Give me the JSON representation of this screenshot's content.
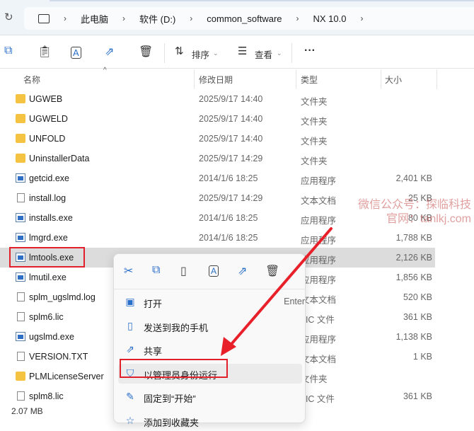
{
  "breadcrumb": [
    "此电脑",
    "软件 (D:)",
    "common_software",
    "NX 10.0"
  ],
  "toolbar": {
    "sort": "排序",
    "view": "查看",
    "more": "···"
  },
  "columns": {
    "name": "名称",
    "date": "修改日期",
    "type": "类型",
    "size": "大小"
  },
  "files": [
    {
      "name": "UGWEB",
      "date": "2025/9/17 14:40",
      "type": "文件夹",
      "size": "",
      "icon": "folder"
    },
    {
      "name": "UGWELD",
      "date": "2025/9/17 14:40",
      "type": "文件夹",
      "size": "",
      "icon": "folder"
    },
    {
      "name": "UNFOLD",
      "date": "2025/9/17 14:40",
      "type": "文件夹",
      "size": "",
      "icon": "folder"
    },
    {
      "name": "UninstallerData",
      "date": "2025/9/17 14:29",
      "type": "文件夹",
      "size": "",
      "icon": "folder"
    },
    {
      "name": "getcid.exe",
      "date": "2014/1/6 18:25",
      "type": "应用程序",
      "size": "2,401 KB",
      "icon": "exe"
    },
    {
      "name": "install.log",
      "date": "2025/9/17 14:29",
      "type": "文本文档",
      "size": "25 KB",
      "icon": "txt"
    },
    {
      "name": "installs.exe",
      "date": "2014/1/6 18:25",
      "type": "应用程序",
      "size": "80 KB",
      "icon": "exe"
    },
    {
      "name": "lmgrd.exe",
      "date": "2014/1/6 18:25",
      "type": "应用程序",
      "size": "1,788 KB",
      "icon": "exe"
    },
    {
      "name": "lmtools.exe",
      "date": "",
      "type": "应用程序",
      "size": "2,126 KB",
      "icon": "exe"
    },
    {
      "name": "lmutil.exe",
      "date": "",
      "type": "应用程序",
      "size": "1,856 KB",
      "icon": "exe"
    },
    {
      "name": "splm_ugslmd.log",
      "date": "",
      "type": "文本文档",
      "size": "520 KB",
      "icon": "txt"
    },
    {
      "name": "splm6.lic",
      "date": "",
      "type": "LIC 文件",
      "size": "361 KB",
      "icon": "txt"
    },
    {
      "name": "ugslmd.exe",
      "date": "",
      "type": "应用程序",
      "size": "1,138 KB",
      "icon": "exe"
    },
    {
      "name": "VERSION.TXT",
      "date": "",
      "type": "文本文档",
      "size": "1 KB",
      "icon": "txt"
    },
    {
      "name": "PLMLicenseServer",
      "date": "",
      "type": "文件夹",
      "size": "",
      "icon": "folder"
    },
    {
      "name": "splm8.lic",
      "date": "",
      "type": "LIC 文件",
      "size": "361 KB",
      "icon": "txt"
    }
  ],
  "context_menu": {
    "items": [
      {
        "label": "打开",
        "shortcut": "Enter",
        "icon": "open-icon"
      },
      {
        "label": "发送到我的手机",
        "shortcut": "",
        "icon": "phone-icon"
      },
      {
        "label": "共享",
        "shortcut": "",
        "icon": "share-icon"
      },
      {
        "label": "以管理员身份运行",
        "shortcut": "",
        "icon": "shield-icon"
      },
      {
        "label": "固定到“开始”",
        "shortcut": "",
        "icon": "pin-icon"
      },
      {
        "label": "添加到收藏夹",
        "shortcut": "",
        "icon": "star-icon"
      }
    ]
  },
  "status": "2.07 MB",
  "watermark": [
    "微信公众号：探临科技",
    "官网：tanlkj.com"
  ],
  "colors": {
    "highlight": "#e0202a",
    "accent": "#2a6fc9"
  }
}
